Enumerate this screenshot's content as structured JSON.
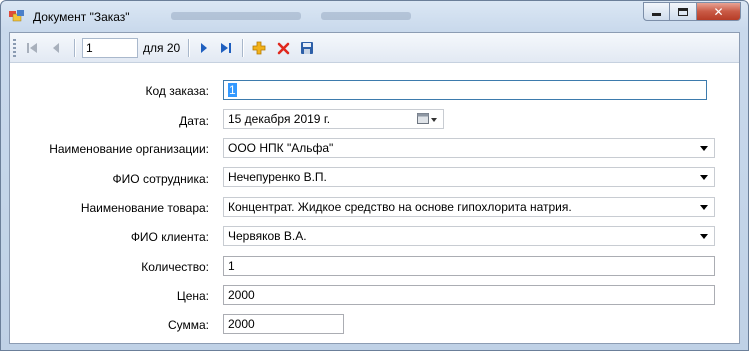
{
  "window": {
    "title": "Документ \"Заказ\"",
    "buttons": {
      "minimize": "▁",
      "maximize": "▢",
      "close": "✕"
    }
  },
  "navigator": {
    "position": "1",
    "count_label": "для 20",
    "icons": [
      "move-first-icon",
      "move-previous-icon",
      "move-next-icon",
      "move-last-icon",
      "add-new-icon",
      "delete-icon",
      "save-icon"
    ]
  },
  "form": {
    "order_code": {
      "label": "Код заказа:",
      "value": "1"
    },
    "date": {
      "label": "Дата:",
      "value": "15 декабря  2019 г."
    },
    "organization": {
      "label": "Наименование организации:",
      "value": "ООО НПК \"Альфа\""
    },
    "employee": {
      "label": "ФИО сотрудника:",
      "value": "Нечепуренко В.П."
    },
    "product": {
      "label": "Наименование товара:",
      "value": "Концентрат. Жидкое средство на основе гипохлорита натрия."
    },
    "client": {
      "label": "ФИО клиента:",
      "value": "Червяков В.А."
    },
    "quantity": {
      "label": "Количество:",
      "value": "1"
    },
    "price": {
      "label": "Цена:",
      "value": "2000"
    },
    "sum": {
      "label": "Сумма:",
      "value": "2000"
    }
  },
  "colors": {
    "accent": "#3399ff",
    "nav_blue": "#1f5fbf",
    "delete_red": "#e0281e",
    "add_yellow": "#f2b21b"
  }
}
